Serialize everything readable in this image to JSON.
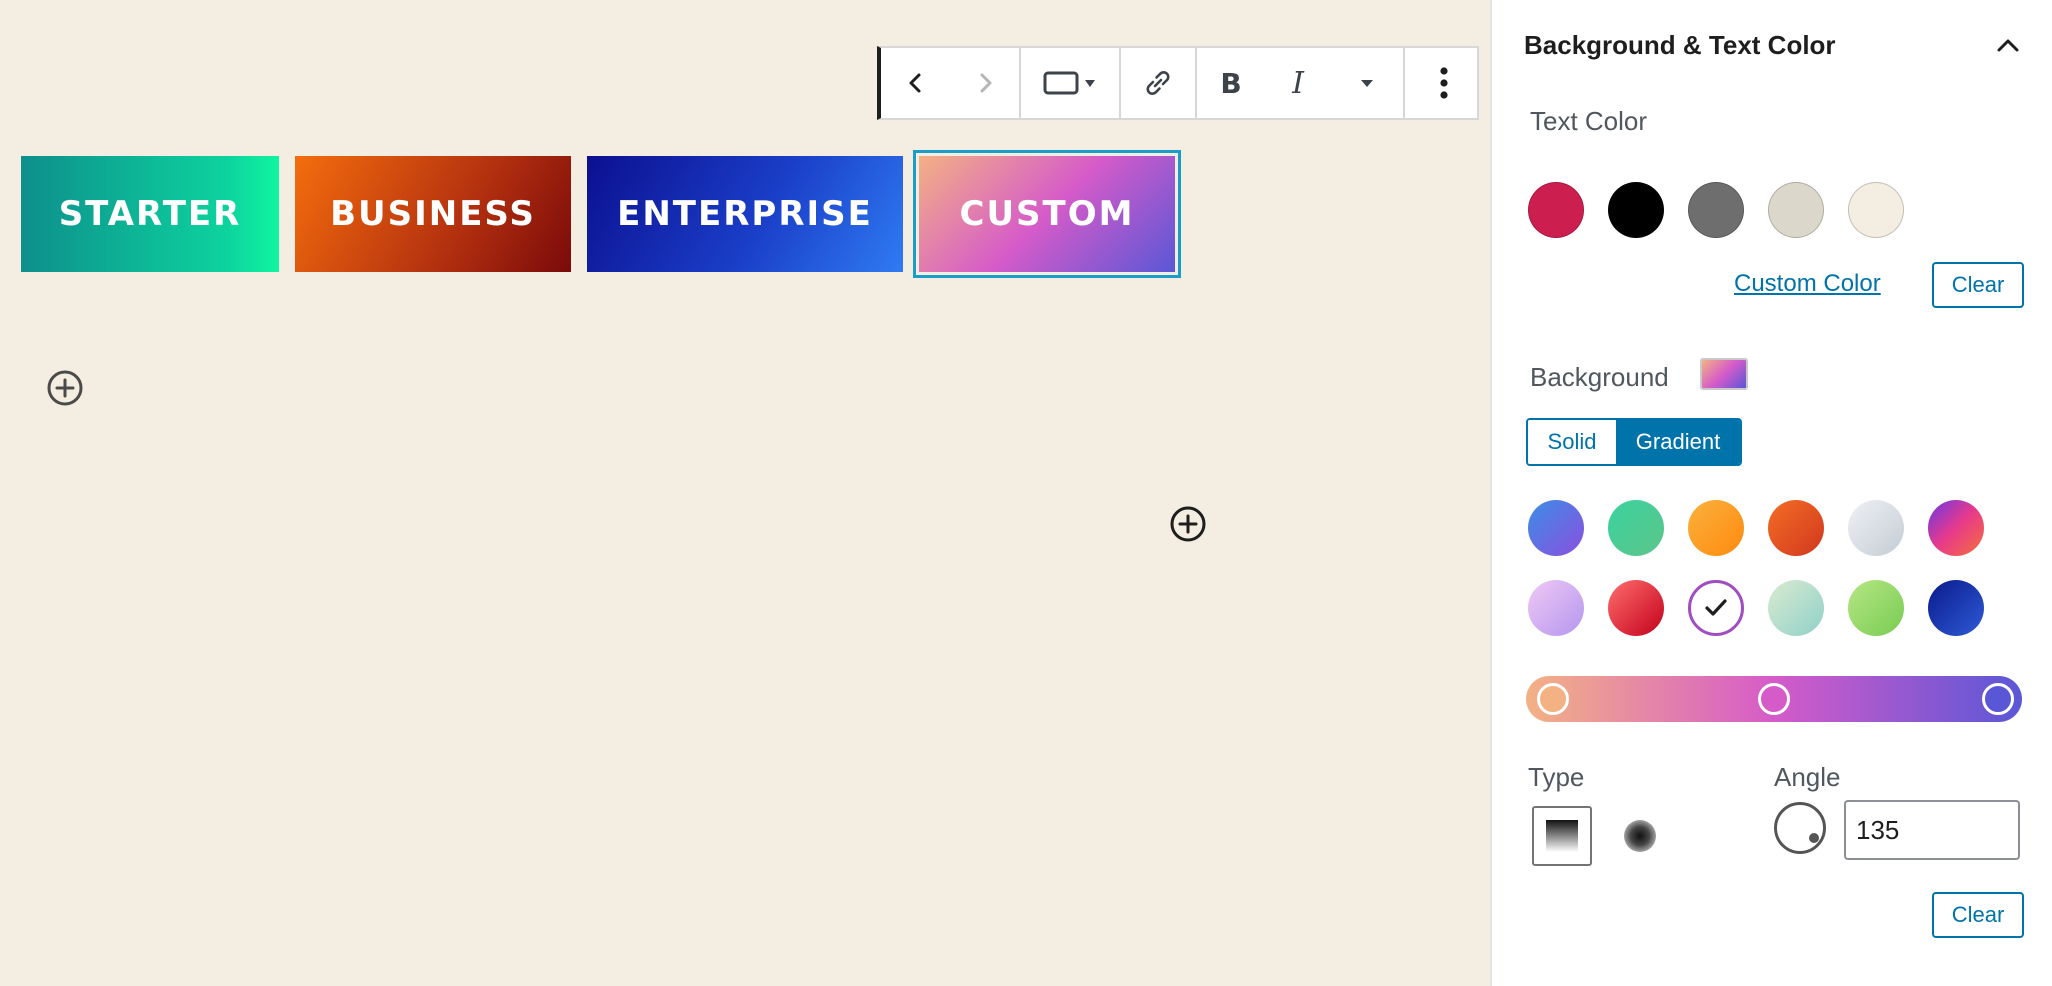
{
  "toolbar": {
    "items": [
      "previous-icon",
      "next-icon",
      "button-width-icon",
      "link-icon",
      "bold-icon",
      "italic-icon",
      "more-formatting-icon",
      "options-icon"
    ],
    "bold_label": "B",
    "italic_label": "I"
  },
  "buttons": [
    {
      "label": "STARTER"
    },
    {
      "label": "BUSINESS"
    },
    {
      "label": "ENTERPRISE"
    },
    {
      "label": "CUSTOM"
    }
  ],
  "panel": {
    "title": "Background & Text Color",
    "text_color": {
      "label": "Text Color",
      "swatches": [
        "#cc1f4f",
        "#000000",
        "#6e6e6e",
        "#dcd7cb",
        "#f4ede2"
      ],
      "custom_color_label": "Custom Color",
      "clear_label": "Clear"
    },
    "background": {
      "label": "Background",
      "solid_label": "Solid",
      "gradient_label": "Gradient",
      "active_mode": "Gradient",
      "gradient_presets_selected_index": 8,
      "stops_colors": [
        "#f3b184",
        "#d55bc9",
        "#5a57d6"
      ],
      "type_label": "Type",
      "angle_label": "Angle",
      "angle_value": "135",
      "clear_label": "Clear"
    }
  },
  "colors": {
    "accent": "#0073aa",
    "selection": "#1a9ec9",
    "canvas_background": "#f4ede2"
  }
}
